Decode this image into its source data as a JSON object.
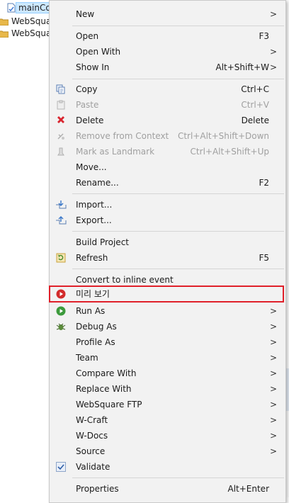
{
  "tree": {
    "items": [
      {
        "label": "mainCo",
        "selected": true,
        "icon": "file-icon"
      },
      {
        "label": "WebSquar",
        "icon": "folder-icon"
      },
      {
        "label": "WebSquar",
        "icon": "folder-icon"
      }
    ]
  },
  "menu": {
    "items": [
      {
        "label": "New",
        "shortcut": "",
        "submenu": true,
        "icon": ""
      },
      {
        "label": "Open",
        "shortcut": "F3",
        "icon": ""
      },
      {
        "label": "Open With",
        "shortcut": "",
        "submenu": true,
        "icon": ""
      },
      {
        "label": "Show In",
        "shortcut": "Alt+Shift+W",
        "submenu": true,
        "icon": ""
      },
      {
        "label": "Copy",
        "shortcut": "Ctrl+C",
        "icon": "copy-icon"
      },
      {
        "label": "Paste",
        "shortcut": "Ctrl+V",
        "icon": "paste-icon",
        "disabled": true
      },
      {
        "label": "Delete",
        "shortcut": "Delete",
        "icon": "delete-icon"
      },
      {
        "label": "Remove from Context",
        "shortcut": "Ctrl+Alt+Shift+Down",
        "icon": "remove-context-icon",
        "disabled": true
      },
      {
        "label": "Mark as Landmark",
        "shortcut": "Ctrl+Alt+Shift+Up",
        "icon": "landmark-icon",
        "disabled": true
      },
      {
        "label": "Move...",
        "shortcut": "",
        "icon": ""
      },
      {
        "label": "Rename...",
        "shortcut": "F2",
        "icon": ""
      },
      {
        "label": "Import...",
        "shortcut": "",
        "icon": "import-icon"
      },
      {
        "label": "Export...",
        "shortcut": "",
        "icon": "export-icon"
      },
      {
        "label": "Build Project",
        "shortcut": "",
        "icon": ""
      },
      {
        "label": "Refresh",
        "shortcut": "F5",
        "icon": "refresh-icon"
      },
      {
        "label": "Convert to inline event",
        "shortcut": "",
        "icon": ""
      },
      {
        "label": "미리 보기",
        "shortcut": "",
        "icon": "preview-icon",
        "highlighted": true
      },
      {
        "label": "Run As",
        "shortcut": "",
        "submenu": true,
        "icon": "run-icon"
      },
      {
        "label": "Debug As",
        "shortcut": "",
        "submenu": true,
        "icon": "debug-icon"
      },
      {
        "label": "Profile As",
        "shortcut": "",
        "submenu": true,
        "icon": ""
      },
      {
        "label": "Team",
        "shortcut": "",
        "submenu": true,
        "icon": ""
      },
      {
        "label": "Compare With",
        "shortcut": "",
        "submenu": true,
        "icon": ""
      },
      {
        "label": "Replace With",
        "shortcut": "",
        "submenu": true,
        "icon": ""
      },
      {
        "label": "WebSquare FTP",
        "shortcut": "",
        "submenu": true,
        "icon": ""
      },
      {
        "label": "W-Craft",
        "shortcut": "",
        "submenu": true,
        "icon": ""
      },
      {
        "label": "W-Docs",
        "shortcut": "",
        "submenu": true,
        "icon": ""
      },
      {
        "label": "Source",
        "shortcut": "",
        "submenu": true,
        "icon": ""
      },
      {
        "label": "Validate",
        "shortcut": "",
        "icon": "check-icon"
      },
      {
        "label": "Properties",
        "shortcut": "Alt+Enter",
        "icon": ""
      }
    ],
    "submenu_arrow": ">"
  },
  "colors": {
    "highlight_border": "#e0202a",
    "menu_bg": "#f2f2f2",
    "disabled_text": "#a0a0a0"
  }
}
